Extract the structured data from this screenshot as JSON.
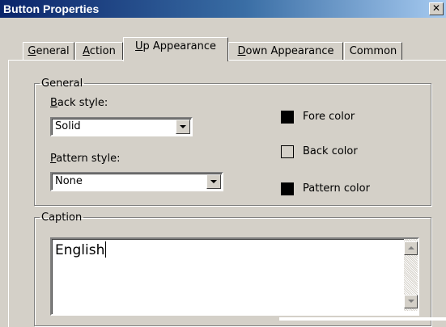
{
  "window": {
    "title": "Button Properties",
    "close_glyph": "✕"
  },
  "tabs": [
    {
      "label": "General",
      "accel": "G",
      "rest": "eneral"
    },
    {
      "label": "Action",
      "accel": "A",
      "rest": "ction"
    },
    {
      "label": "Up Appearance",
      "accel": "U",
      "rest": "p Appearance"
    },
    {
      "label": "Down Appearance",
      "accel": "D",
      "rest": "own Appearance"
    },
    {
      "label": "Common",
      "accel": "",
      "rest": "Common"
    }
  ],
  "active_tab": "Up Appearance",
  "general": {
    "legend": "General",
    "back_style_accel": "B",
    "back_style_rest": "ack style:",
    "back_style_value": "Solid",
    "pattern_style_accel": "P",
    "pattern_style_rest": "attern style:",
    "pattern_style_value": "None",
    "fore_color_label": "Fore color",
    "back_color_label": "Back color",
    "pattern_color_label": "Pattern color",
    "colors": {
      "fore": "#000000",
      "back": "#d4d0c8",
      "pattern": "#000000"
    }
  },
  "caption": {
    "legend": "Caption",
    "text": "English"
  }
}
